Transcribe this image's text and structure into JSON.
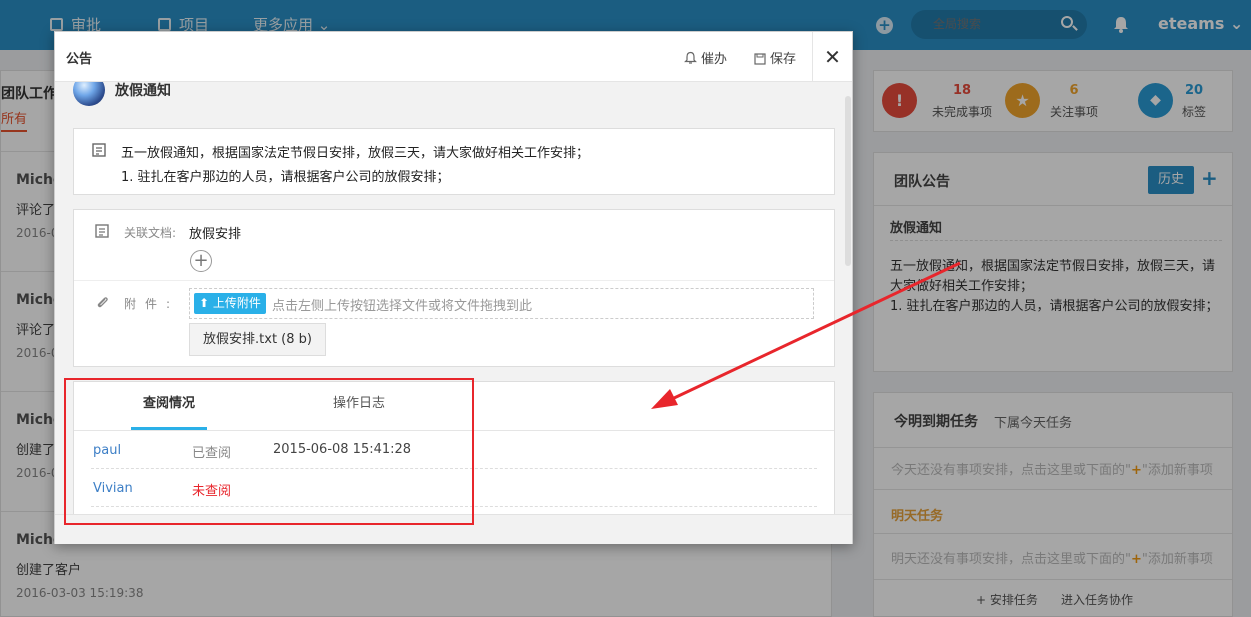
{
  "topbar": {
    "nav": [
      "审批",
      "项目",
      "更多应用 ⌄"
    ],
    "search_placeholder": "全局搜索",
    "brand": "eteams ⌄"
  },
  "left": {
    "title": "团队工作",
    "tab": "所有",
    "feed": [
      {
        "name": "Miche",
        "action": "评论了",
        "time": "2016-0"
      },
      {
        "name": "Miche",
        "action": "评论了",
        "time": "2016-0"
      },
      {
        "name": "Miche",
        "action": "创建了",
        "time": "2016-0"
      },
      {
        "name": "Miche",
        "action": "创建了客户",
        "time": "2016-03-03 15:19:38"
      }
    ]
  },
  "stats": [
    {
      "value": "18",
      "label": "未完成事项",
      "icon": "exclamation-icon",
      "color": "#e84c3d"
    },
    {
      "value": "6",
      "label": "关注事项",
      "icon": "star-icon",
      "color": "#f2a52b"
    },
    {
      "value": "20",
      "label": "标签",
      "icon": "tag-icon",
      "color": "#2a9bd6"
    }
  ],
  "team_notice": {
    "header": "团队公告",
    "history_btn": "历史",
    "add": "+",
    "title": "放假通知",
    "body": "五一放假通知，根据国家法定节假日安排，放假三天，请大家做好相关工作安排；\n1. 驻扎在客户那边的人员，请根据客户公司的放假安排；"
  },
  "tasks": {
    "title": "今明到期任务",
    "sub": "下属今天任务",
    "today_empty_pre": "今天还没有事项安排，点击这里或下面的\"",
    "today_empty_mid": "+",
    "today_empty_post": "\"添加新事项",
    "tomorrow": "明天任务",
    "tomorrow_empty_pre": "明天还没有事项安排，点击这里或下面的\"",
    "tomorrow_empty_mid": "+",
    "tomorrow_empty_post": "\"添加新事项",
    "footer_arrange": "+ 安排任务",
    "footer_collab": "进入任务协作"
  },
  "modal": {
    "title": "公告",
    "remind": "催办",
    "save": "保存",
    "close": "✕",
    "announcement_name": "放假通知",
    "content_line1": "五一放假通知，根据国家法定节假日安排，放假三天，请大家做好相关工作安排；",
    "content_line2": "1. 驻扎在客户那边的人员，请根据客户公司的放假安排；",
    "related_doc_label": "关联文档:",
    "related_doc": "放假安排",
    "attachment_label": "附件:",
    "upload_btn": "上传附件",
    "upload_hint": "点击左侧上传按钮选择文件或将文件拖拽到此",
    "file": "放假安排.txt (8 b)",
    "tabs": [
      "查阅情况",
      "操作日志"
    ],
    "read_rows": [
      {
        "user": "paul",
        "status": "已查阅",
        "time": "2015-06-08 15:41:28",
        "status_color": "#888888"
      },
      {
        "user": "Vivian",
        "status": "未查阅",
        "time": "",
        "status_color": "#e8262c"
      }
    ]
  }
}
